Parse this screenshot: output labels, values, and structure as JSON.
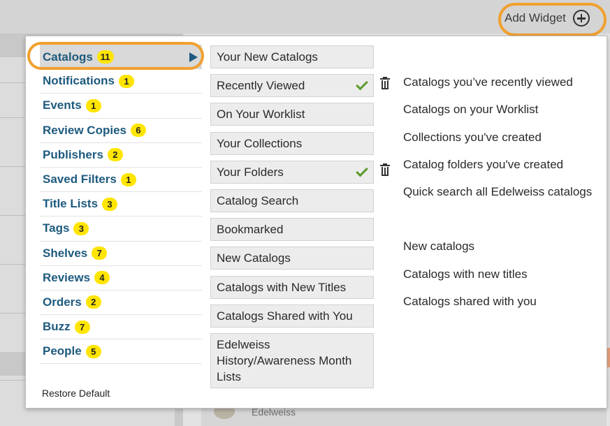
{
  "header": {
    "add_widget_label": "Add Widget",
    "add_widget_icon": "plus-circle-icon"
  },
  "background": {
    "card_text": "Edelweiss"
  },
  "nav": {
    "items": [
      {
        "label": "Catalogs",
        "count": "11",
        "active": true
      },
      {
        "label": "Notifications",
        "count": "1"
      },
      {
        "label": "Events",
        "count": "1"
      },
      {
        "label": "Review Copies",
        "count": "6"
      },
      {
        "label": "Publishers",
        "count": "2"
      },
      {
        "label": "Saved Filters",
        "count": "1"
      },
      {
        "label": "Title Lists",
        "count": "3"
      },
      {
        "label": "Tags",
        "count": "3"
      },
      {
        "label": "Shelves",
        "count": "7"
      },
      {
        "label": "Reviews",
        "count": "4"
      },
      {
        "label": "Orders",
        "count": "2"
      },
      {
        "label": "Buzz",
        "count": "7"
      },
      {
        "label": "People",
        "count": "5"
      }
    ],
    "active_arrow_icon": "play-arrow-icon"
  },
  "widgets": [
    {
      "label": "Your New Catalogs",
      "description": "",
      "added": false
    },
    {
      "label": "Recently Viewed",
      "description": "Catalogs you’ve recently viewed",
      "added": true
    },
    {
      "label": "On Your Worklist",
      "description": "Catalogs on your Worklist",
      "added": false
    },
    {
      "label": "Your Collections",
      "description": "Collections you've created",
      "added": false
    },
    {
      "label": "Your Folders",
      "description": "Catalog folders you've created",
      "added": true
    },
    {
      "label": "Catalog Search",
      "description": "Quick search all Edelweiss catalogs",
      "added": false
    },
    {
      "label": "Bookmarked",
      "description": "",
      "added": false
    },
    {
      "label": "New Catalogs",
      "description": "New catalogs",
      "added": false
    },
    {
      "label": "Catalogs with New Titles",
      "description": "Catalogs with new titles",
      "added": false
    },
    {
      "label": "Catalogs Shared with You",
      "description": "Catalogs shared with you",
      "added": false
    },
    {
      "label": "Edelweiss History/Awareness Month Lists",
      "description": "",
      "added": false
    }
  ],
  "footer": {
    "restore_label": "Restore Default"
  },
  "colors": {
    "nav_text": "#1e5a7e",
    "badge": "#ffe500",
    "highlight_ring": "#f0a030",
    "check": "#5c9a2c"
  }
}
